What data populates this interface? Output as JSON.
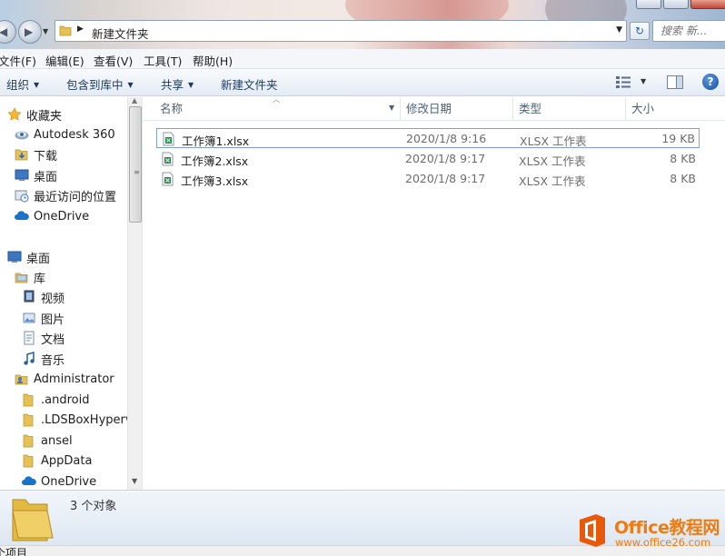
{
  "window": {
    "address_path": "新建文件夹",
    "search_placeholder": "搜索 新..."
  },
  "menu": [
    "文件(F)",
    "编辑(E)",
    "查看(V)",
    "工具(T)",
    "帮助(H)"
  ],
  "toolbar": {
    "organize": "组织",
    "include_library": "包含到库中",
    "share": "共享",
    "new_folder": "新建文件夹"
  },
  "nav": {
    "favorites": {
      "label": "收藏夹",
      "icon": "star-icon"
    },
    "items": [
      {
        "label": "Autodesk 360",
        "icon": "autodesk-360-icon"
      },
      {
        "label": "下载",
        "icon": "download-folder-icon"
      },
      {
        "label": "桌面",
        "icon": "desktop-icon"
      },
      {
        "label": "最近访问的位置",
        "icon": "recent-places-icon"
      },
      {
        "label": "OneDrive",
        "icon": "onedrive-cloud-icon"
      }
    ],
    "desktop": {
      "label": "桌面",
      "icon": "desktop-icon"
    },
    "library": {
      "label": "库",
      "icon": "library-icon"
    },
    "library_items": [
      {
        "label": "视频",
        "icon": "video-library-icon"
      },
      {
        "label": "图片",
        "icon": "pictures-library-icon"
      },
      {
        "label": "文档",
        "icon": "documents-library-icon"
      },
      {
        "label": "音乐",
        "icon": "music-library-icon"
      }
    ],
    "user": {
      "label": "Administrator",
      "icon": "user-folder-icon"
    },
    "user_items": [
      {
        "label": ".android",
        "icon": "folder-icon"
      },
      {
        "label": ".LDSBoxHyperv",
        "icon": "folder-icon"
      },
      {
        "label": "ansel",
        "icon": "folder-icon"
      },
      {
        "label": "AppData",
        "icon": "folder-icon"
      },
      {
        "label": "OneDrive",
        "icon": "onedrive-cloud-icon"
      }
    ]
  },
  "columns": {
    "name": "名称",
    "date": "修改日期",
    "type": "类型",
    "size": "大小"
  },
  "files": [
    {
      "name": "工作簿1.xlsx",
      "date": "2020/1/8 9:16",
      "type": "XLSX 工作表",
      "size": "19 KB",
      "selected": true
    },
    {
      "name": "工作簿2.xlsx",
      "date": "2020/1/8 9:17",
      "type": "XLSX 工作表",
      "size": "8 KB",
      "selected": false
    },
    {
      "name": "工作簿3.xlsx",
      "date": "2020/1/8 9:17",
      "type": "XLSX 工作表",
      "size": "8 KB",
      "selected": false
    }
  ],
  "details": {
    "count_text": "3 个对象"
  },
  "status": {
    "text": "个项目"
  },
  "watermark": {
    "title": "Office教程网",
    "url": "www.office26.com",
    "brand_color": "#f07b10"
  },
  "colors": {
    "selection_border": "#7da2ce",
    "toolbar_text": "#1e395b",
    "secondary_text": "#6d6d6d"
  }
}
